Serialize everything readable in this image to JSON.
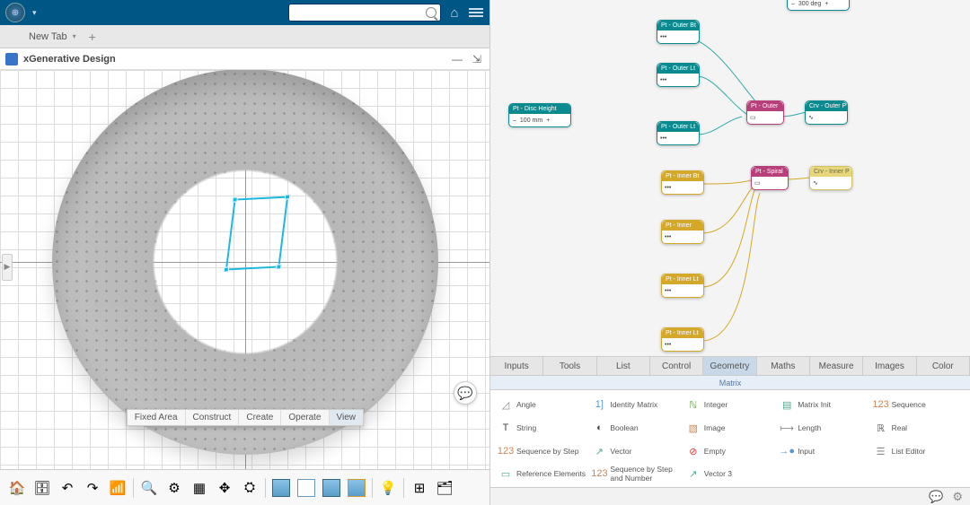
{
  "topbar": {
    "search_placeholder": ""
  },
  "tabs": {
    "new_tab": "New Tab"
  },
  "title": "xGenerative Design",
  "context_menu": [
    "Fixed Area",
    "Construct",
    "Create",
    "Operate",
    "View"
  ],
  "param_nodes": {
    "disc_height": {
      "label": "Pt - Disc Height",
      "value": "100 mm"
    },
    "top_deg": {
      "label": "",
      "value": "300 deg"
    }
  },
  "nodes": {
    "n1": "Pt - Outer Bt",
    "n2": "Pt - Outer Lt",
    "n3": "Pt - Outer",
    "n4": "Crv - Outer P",
    "n5": "Pt - Outer Lt",
    "n6": "Pt - Spiral",
    "n7": "Crv - Inner P",
    "n8": "Pt - Inner Bt",
    "n9": "Pt - Inner",
    "n10": "Pt - Inner Lt",
    "n11": "Pt - Inner Lt"
  },
  "tool_tabs": [
    "Inputs",
    "Tools",
    "List",
    "Control",
    "Geometry",
    "Maths",
    "Measure",
    "Images",
    "Color"
  ],
  "tool_tabs_active": 4,
  "tool_subhead": "Matrix",
  "tools": {
    "angle": "Angle",
    "identity": "Identity Matrix",
    "integer": "Integer",
    "minit": "Matrix Init",
    "seq": "Sequence",
    "string": "String",
    "boolean": "Boolean",
    "image": "Image",
    "length": "Length",
    "real": "Real",
    "seqstep": "Sequence by Step",
    "vector": "Vector",
    "empty": "Empty",
    "input": "Input",
    "listedit": "List Editor",
    "ref": "Reference Elements",
    "seqnum": "Sequence by Step and Number",
    "vector3": "Vector 3"
  }
}
